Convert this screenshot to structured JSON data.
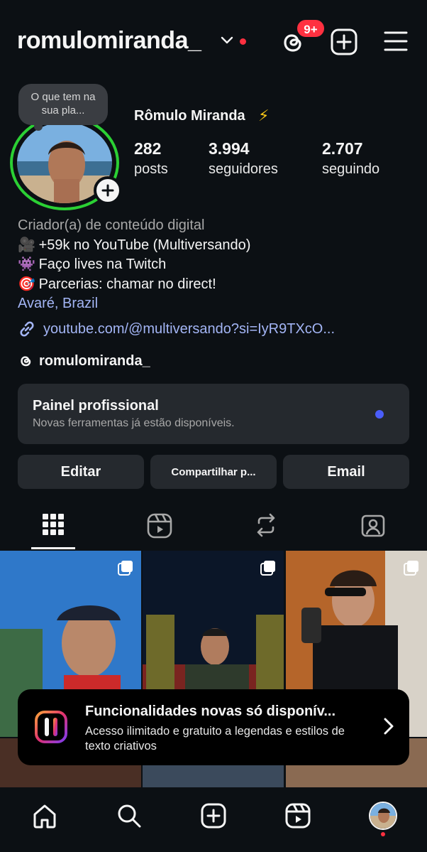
{
  "header": {
    "username": "romulomiranda_",
    "notification_badge": "9+",
    "icons": [
      "chevron-down-icon",
      "threads-icon",
      "create-plus-icon",
      "hamburger-menu-icon"
    ]
  },
  "profile": {
    "note": "O que tem na sua pla...",
    "full_name": "Rômulo Miranda",
    "name_emoji": "⚡",
    "stats": [
      {
        "value": "282",
        "label": "posts"
      },
      {
        "value": "3.994",
        "label": "seguidores"
      },
      {
        "value": "2.707",
        "label": "seguindo"
      }
    ],
    "category": "Criador(a) de conteúdo digital",
    "bio_lines": [
      {
        "emoji": "🎥",
        "text": "+59k no YouTube (Multiversando)"
      },
      {
        "emoji": "👾",
        "text": "Faço lives na Twitch"
      },
      {
        "emoji": "🎯",
        "text": "Parcerias: chamar no direct!"
      }
    ],
    "location": "Avaré, Brazil",
    "link": "youtube.com/@multiversando?si=IyR9TXcO...",
    "threads_handle": "romulomiranda_"
  },
  "panel": {
    "title": "Painel profissional",
    "subtitle": "Novas ferramentas já estão disponíveis."
  },
  "actions": {
    "edit": "Editar",
    "share": "Compartilhar p...",
    "email": "Email"
  },
  "toast": {
    "title": "Funcionalidades novas só disponív...",
    "subtitle": "Acesso ilimitado e gratuito a legendas e estilos de texto criativos"
  },
  "colors": {
    "background": "#0c1014",
    "surface": "#25292e",
    "story_ring": "#2bd034",
    "badge_red": "#ff3040",
    "link_blue": "#a3b5f5",
    "dot_blue": "#4a5df9"
  }
}
